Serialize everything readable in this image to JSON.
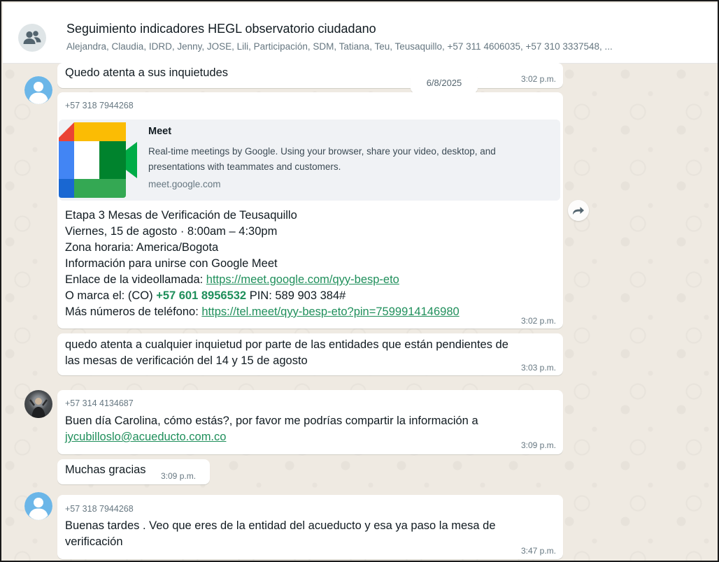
{
  "header": {
    "title": "Seguimiento indicadores HEGL observatorio ciudadano",
    "members": "Alejandra, Claudia, IDRD, Jenny, JOSE, Lili, Participación, SDM, Tatiana, Teu, Teusaquillo, +57 311 4606035, +57 310 3337548, ..."
  },
  "date_chip": "6/8/2025",
  "messages": [
    {
      "text": "Quedo atenta a sus inquietudes",
      "time": "3:02 p.m."
    },
    {
      "sender": "+57 318 7944268",
      "preview": {
        "title": "Meet",
        "description": "Real-time meetings by Google. Using your browser, share your video, desktop, and presentations with teammates and customers.",
        "domain": "meet.google.com"
      },
      "line1": "Etapa 3 Mesas de Verificación de Teusaquillo",
      "line2": "Viernes, 15 de agosto · 8:00am – 4:30pm",
      "line3": "Zona horaria: America/Bogota",
      "line4": "Información para unirse con Google Meet",
      "line5_prefix": "Enlace de la videollamada: ",
      "line5_link": "https://meet.google.com/qyy-besp-eto",
      "line6_prefix": "O marca el: (CO) ",
      "line6_phone": "+57 601 8956532",
      "line6_suffix": " PIN: 589 903 384#",
      "line7_prefix": "Más números de teléfono: ",
      "line7_link": "https://tel.meet/qyy-besp-eto?pin=7599914146980",
      "time": "3:02 p.m."
    },
    {
      "line1": "quedo atenta a cualquier inquietud por parte de las entidades que están pendientes de",
      "line2": "las mesas de verificación del 14 y 15 de agosto",
      "time": "3:03 p.m."
    },
    {
      "sender": "+57 314 4134687",
      "line1": "Buen día Carolina, cómo estás?, por favor me podrías compartir la información a",
      "line2_link": "jycubilloslo@acueducto.com.co",
      "time": "3:09 p.m."
    },
    {
      "text": "Muchas gracias",
      "time": "3:09 p.m."
    },
    {
      "sender": "+57 318 7944268",
      "line1": "Buenas tardes . Veo que eres de la entidad del acueducto y esa ya paso la mesa de",
      "line2": "verificación",
      "time": "3:47 p.m."
    }
  ],
  "colors": {
    "chat_background": "#efeae2",
    "bubble": "#ffffff",
    "link": "#027eb5",
    "meet_link_green": "#1f8f5b",
    "meta_text": "#667781"
  },
  "icons": [
    "group-avatar-icon",
    "user-avatar-icon",
    "forward-icon",
    "google-meet-logo"
  ]
}
